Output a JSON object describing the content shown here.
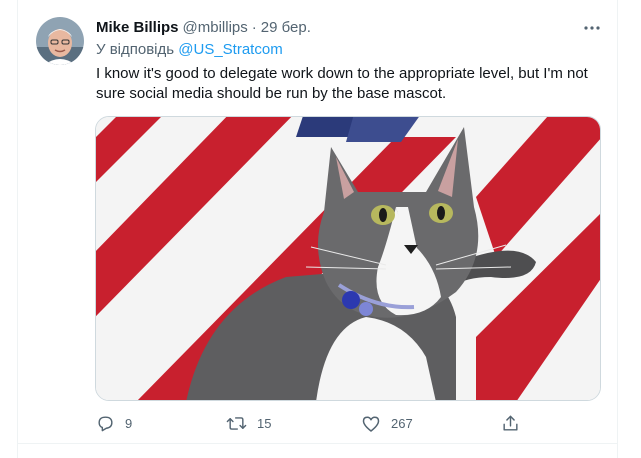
{
  "tweet": {
    "author_name": "Mike Billips",
    "author_handle": "@mbillips",
    "separator": "·",
    "date": "29 бер.",
    "reply_prefix": "У відповідь",
    "reply_to": "@US_Stratcom",
    "text": "I know it's good to delegate work down to the appropriate level, but I'm not sure social media should be run by the base mascot.",
    "media_description_icon": "photo"
  },
  "actions": {
    "reply_count": "9",
    "retweet_count": "15",
    "like_count": "267",
    "reply_icon": "reply-icon",
    "retweet_icon": "retweet-icon",
    "like_icon": "heart-icon",
    "share_icon": "share-icon"
  },
  "colors": {
    "link": "#1d9bf0",
    "secondary_text": "#536471",
    "primary_text": "#0f1419",
    "flag_red": "#c8202e",
    "flag_blue": "#2b3a7a"
  }
}
